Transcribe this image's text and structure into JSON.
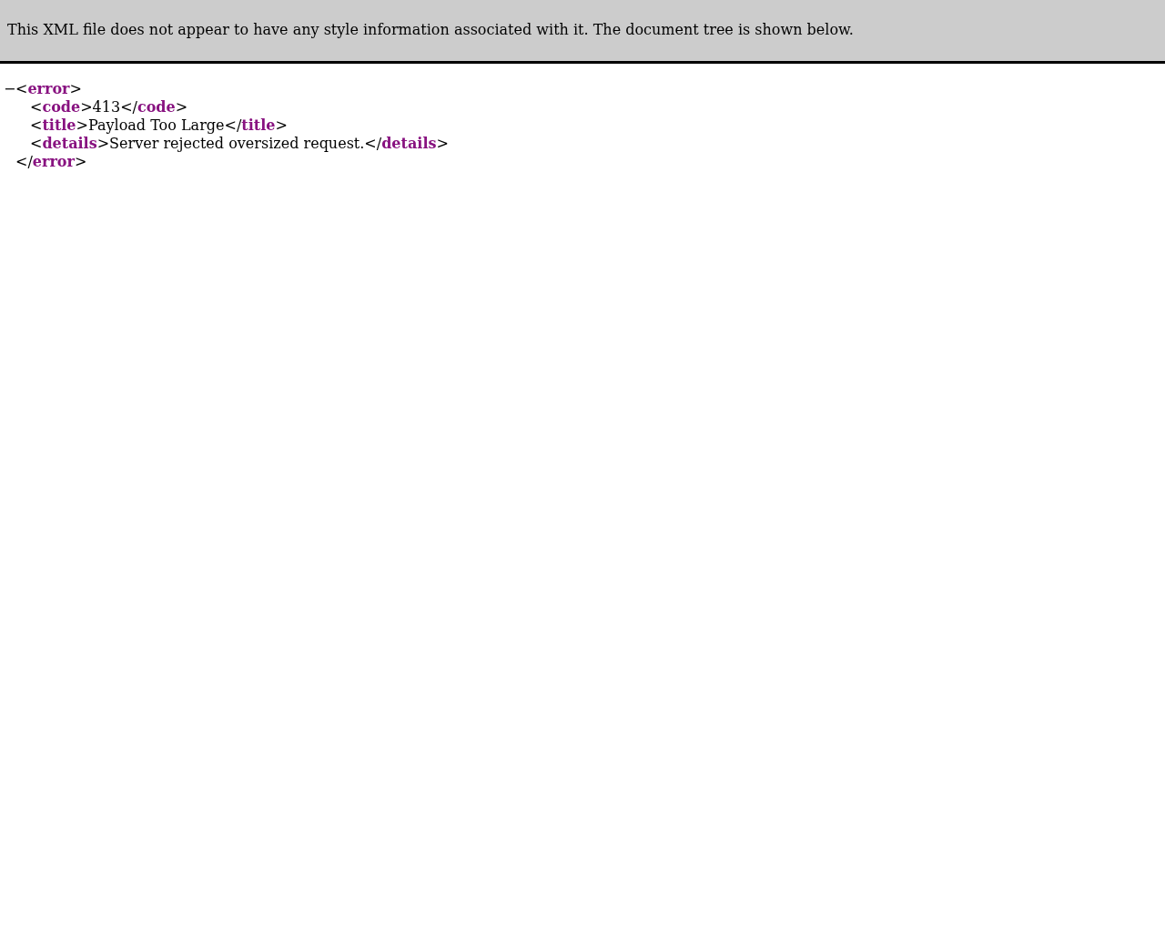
{
  "banner": "This XML file does not appear to have any style information associated with it. The document tree is shown below.",
  "tree": {
    "toggle": "−",
    "expanded": true,
    "open_line": "<**error**>",
    "children": [
      "<**code**>413</**code**>",
      "<**title**>Payload Too Large</**title**>",
      "<**details**>Server rejected oversized request.</**details**>"
    ],
    "close_line": "</**error**>"
  }
}
